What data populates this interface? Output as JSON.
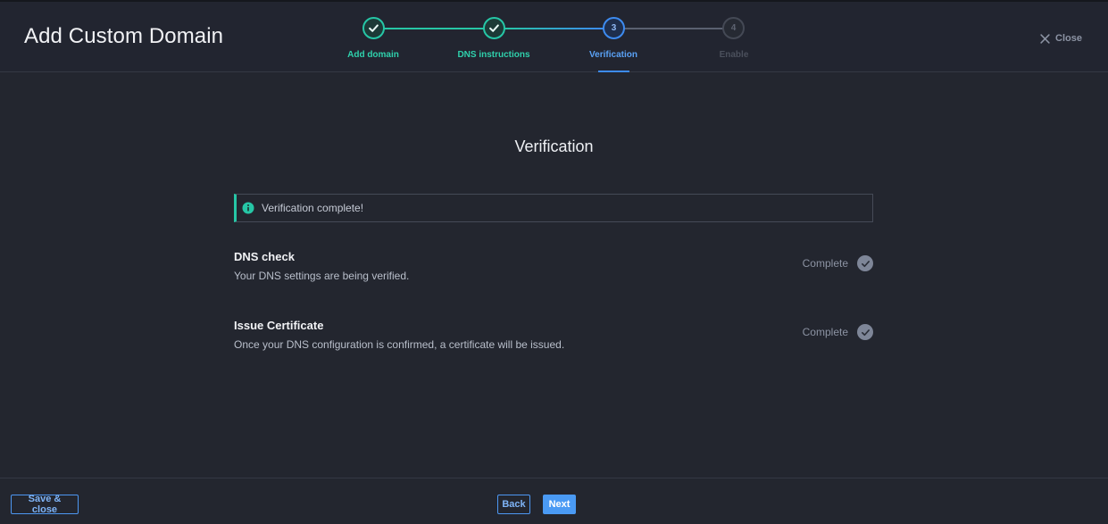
{
  "header": {
    "title": "Add Custom Domain",
    "close_label": "Close"
  },
  "stepper": {
    "steps": [
      {
        "number": "1",
        "label": "Add domain",
        "state": "complete"
      },
      {
        "number": "2",
        "label": "DNS instructions",
        "state": "complete"
      },
      {
        "number": "3",
        "label": "Verification",
        "state": "active"
      },
      {
        "number": "4",
        "label": "Enable",
        "state": "upcoming"
      }
    ]
  },
  "main": {
    "section_title": "Verification",
    "alert": {
      "text": "Verification complete!",
      "icon": "info-icon"
    },
    "checks": [
      {
        "title": "DNS check",
        "description": "Your DNS settings are being verified.",
        "status": "Complete",
        "icon": "check-circle-icon"
      },
      {
        "title": "Issue Certificate",
        "description": "Once your DNS configuration is confirmed, a certificate will be issued.",
        "status": "Complete",
        "icon": "check-circle-icon"
      }
    ]
  },
  "footer": {
    "save_close_label": "Save & close",
    "back_label": "Back",
    "next_label": "Next"
  },
  "colors": {
    "background": "#23262f",
    "complete_accent": "#26c6a6",
    "active_accent": "#3d8bf0",
    "primary_button": "#4a9af4"
  }
}
